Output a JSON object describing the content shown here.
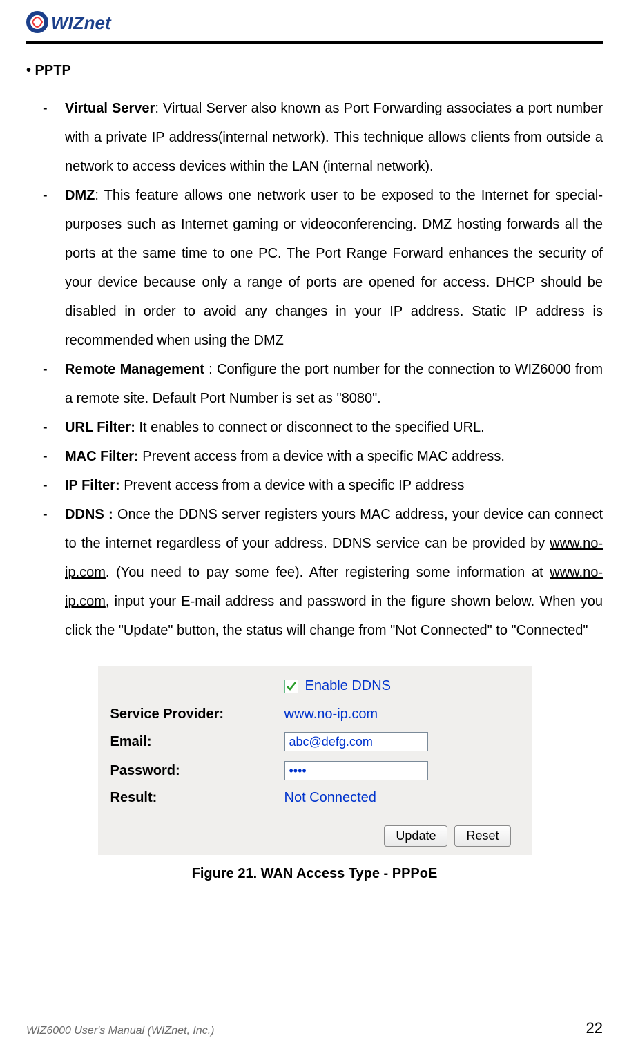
{
  "brand": "WIZnet",
  "section_title": "• PPTP",
  "items": [
    {
      "title": "Virtual Server",
      "sep": ": ",
      "body": "Virtual Server also known as Port Forwarding associates a port number with a private IP address(internal network). This technique allows clients from outside a network to access devices within the LAN (internal network)."
    },
    {
      "title": "DMZ",
      "sep": ": ",
      "body": "This feature allows one network user to be exposed to the Internet for special-purposes such as Internet gaming or videoconferencing. DMZ hosting forwards all the ports at the same time to one PC. The Port Range Forward enhances the security of your device because only a range of ports are opened for access. DHCP should be disabled in order to avoid any changes in your IP address. Static IP address is recommended when using the DMZ"
    },
    {
      "title": "Remote Management",
      "sep": " : ",
      "body": "Configure the port number for the connection to WIZ6000 from a remote site. Default Port Number is set as \"8080\"."
    },
    {
      "title": "URL Filter:",
      "sep": " ",
      "body": "It enables to connect or disconnect to the specified URL."
    },
    {
      "title": "MAC Filter:",
      "sep": " ",
      "body": "Prevent access from a device with a specific MAC address."
    },
    {
      "title": "IP Filter:",
      "sep": " ",
      "body": "Prevent access from a device with a specific IP address"
    }
  ],
  "ddns": {
    "title": "DDNS :",
    "pre": " Once the DDNS server registers yours MAC address, your device can connect to the internet regardless of your address. DDNS service can be provided by ",
    "link1": "www.no-ip.com",
    "mid1": ". (You need to pay some fee). After registering some information at ",
    "link2": "www.no-ip.com",
    "post": ", input your E-mail address and password in the figure shown below. When you click the \"Update\" button, the status will change from \"Not Connected\" to \"Connected\""
  },
  "fig": {
    "enable_label": "Enable DDNS",
    "rows": {
      "provider_label": "Service Provider:",
      "provider_value": "www.no-ip.com",
      "email_label": "Email:",
      "email_value": "abc@defg.com",
      "password_label": "Password:",
      "password_value": "••••",
      "result_label": "Result:",
      "result_value": "Not Connected"
    },
    "buttons": {
      "update": "Update",
      "reset": "Reset"
    }
  },
  "caption": "Figure 21. WAN Access Type - PPPoE",
  "footer": {
    "left_pre": "WIZ6000 User's Manual ",
    "left_company": "(WIZnet, Inc.)",
    "page_no": "22"
  }
}
